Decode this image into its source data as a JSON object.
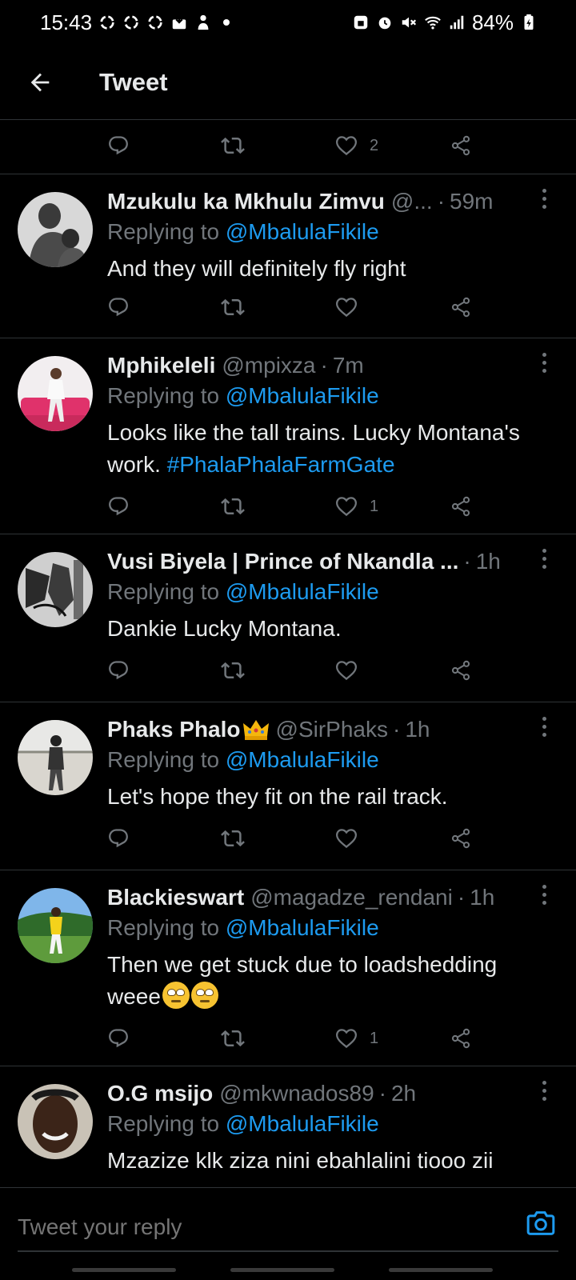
{
  "status_bar": {
    "time": "15:43",
    "battery": "84%",
    "icons": [
      "recycle-icon",
      "recycle-icon",
      "recycle-icon",
      "download-box-icon",
      "person-icon",
      "dot-icon",
      "lock-battery-icon",
      "alarm-icon",
      "mute-icon",
      "wifi-icon",
      "signal-icon",
      "battery-icon"
    ]
  },
  "header": {
    "back_icon": "arrow-left-icon",
    "title": "Tweet"
  },
  "top_actions": {
    "like_count": "2"
  },
  "tweets": [
    {
      "name": "Mzukulu ka Mkhulu Zimvu",
      "handle": "@...",
      "time": "59m",
      "replying_prefix": "Replying to",
      "mention": "@MbalulaFikile",
      "text": "And they will definitely fly right",
      "like_count": ""
    },
    {
      "name": "Mphikeleli",
      "handle": "@mpixza",
      "time": "7m",
      "replying_prefix": "Replying to",
      "mention": "@MbalulaFikile",
      "text": "Looks like the tall trains. Lucky Montana's work.",
      "hashtag": "#PhalaPhalaFarmGate",
      "like_count": "1"
    },
    {
      "name": "Vusi Biyela | Prince of Nkandla ...",
      "handle": "",
      "time": "1h",
      "replying_prefix": "Replying to",
      "mention": "@MbalulaFikile",
      "text": "Dankie Lucky Montana.",
      "like_count": ""
    },
    {
      "name": "Phaks Phalo",
      "handle": "@SirPhaks",
      "time": "1h",
      "replying_prefix": "Replying to",
      "mention": "@MbalulaFikile",
      "text": "Let's hope they fit on the rail track.",
      "like_count": ""
    },
    {
      "name": "Blackieswart",
      "handle": "@magadze_rendani",
      "time": "1h",
      "replying_prefix": "Replying to",
      "mention": "@MbalulaFikile",
      "text": "Then we get stuck due to loadshedding weee",
      "like_count": "1"
    },
    {
      "name": "O.G msijo",
      "handle": "@mkwnados89",
      "time": "2h",
      "replying_prefix": "Replying to",
      "mention": "@MbalulaFikile",
      "text": "Mzazize klk ziza nini ebahlalini tiooo zii"
    }
  ],
  "reply_bar": {
    "placeholder": "Tweet your reply",
    "camera_icon": "camera-icon"
  },
  "colors": {
    "background": "#000000",
    "text": "#e7e9ea",
    "secondary": "#71767b",
    "accent": "#1d9bf0",
    "divider": "#2f3336"
  }
}
